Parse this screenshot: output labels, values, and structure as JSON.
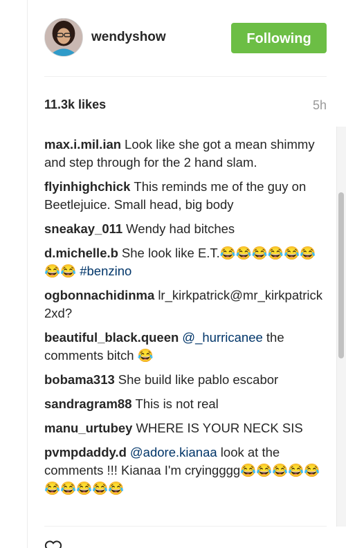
{
  "post": {
    "username": "wendyshow",
    "follow_label": "Following",
    "likes": "11.3k likes",
    "time": "5h"
  },
  "comments": [
    {
      "author": "max.i.mil.ian",
      "text": "Look like she got a mean shimmy and step through for the 2 hand slam."
    },
    {
      "author": "flyinhighchick",
      "text": "This reminds me of the guy on Beetlejuice. Small head, big body"
    },
    {
      "author": "sneakay_011",
      "text": "Wendy had bitches"
    },
    {
      "author": "d.michelle.b",
      "text": "She look like E.T.😂😂😂😂😂😂😂😂",
      "hashtag": "#benzino"
    },
    {
      "author": "ogbonnachidinma",
      "text": "lr_kirkpatrick@mr_kirkpatrick2xd?"
    },
    {
      "author": "beautiful_black.queen",
      "mention": "@_hurricanee",
      "text": "the comments bitch 😂"
    },
    {
      "author": "bobama313",
      "text": "She build like pablo escabor"
    },
    {
      "author": "sandragram88",
      "text": "This is not real"
    },
    {
      "author": "manu_urtubey",
      "text": "WHERE IS YOUR NECK SIS"
    },
    {
      "author": "pvmpdaddy.d",
      "mention": "@adore.kianaa",
      "text": "look at the comments !!! Kianaa I'm cryingggg😂😂😂😂😂😂😂😂😂😂"
    }
  ],
  "icons": {
    "avatar": "profile-photo",
    "bottom": "heart-icon"
  },
  "colors": {
    "follow_button": "#6cbe45",
    "link": "#003569",
    "muted": "#999999"
  }
}
